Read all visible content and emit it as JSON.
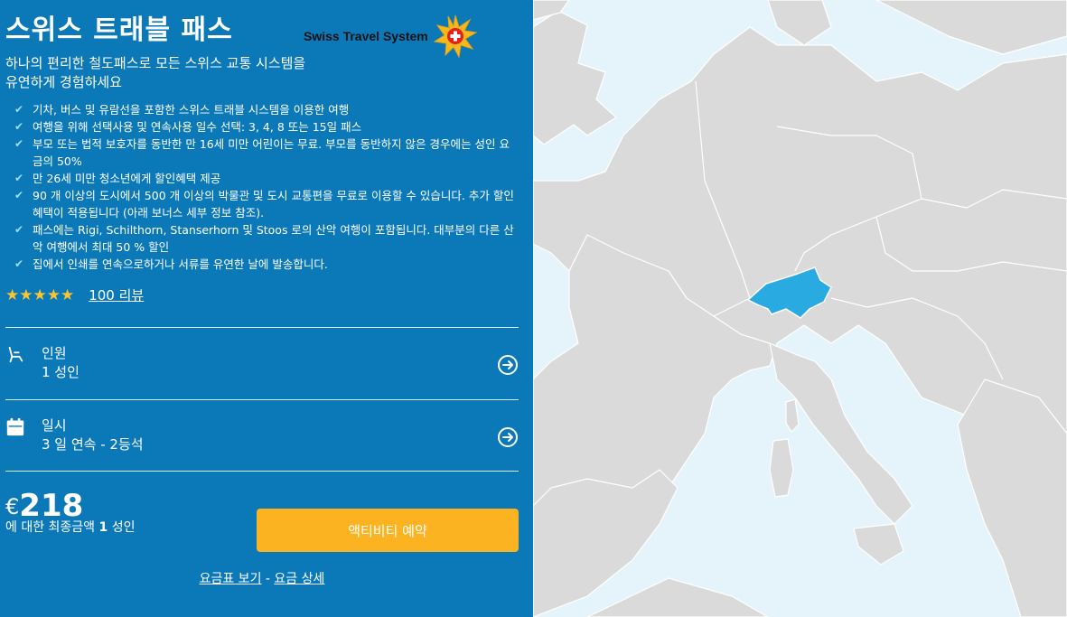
{
  "product": {
    "title": "스위스 트래블 패스",
    "logo_text": "Swiss Travel System",
    "subtitle": "하나의 편리한 철도패스로 모든 스위스 교통 시스템을 유연하게 경험하세요"
  },
  "features": [
    "기차, 버스 및 유람선을 포함한 스위스 트래블 시스템을 이용한 여행",
    "여행을 위해 선택사용 및 연속사용 일수 선택: 3, 4, 8 또는 15일 패스",
    "부모 또는 법적 보호자를 동반한 만 16세 미만 어린이는 무료. 부모를 동반하지 않은 경우에는 성인 요금의 50%",
    "만 26세 미만 청소년에게 할인혜택 제공",
    "90 개 이상의 도시에서 500 개 이상의 박물관 및 도시 교통편을 무료로 이용할 수 있습니다. 추가 할인 혜택이 적용됩니다 (아래 보너스 세부 정보 참조).",
    "패스에는 Rigi, Schilthorn, Stanserhorn 및 Stoos 로의 산악 여행이 포함됩니다. 대부분의 다른 산악 여행에서 최대 50 % 할인",
    "집에서 인쇄를 연속으로하거나 서류를 유연한 날에 발송합니다."
  ],
  "rating": {
    "stars": "★★★★★",
    "reviews_label": "100 리뷰"
  },
  "travellers": {
    "label": "인원",
    "value": "1 성인"
  },
  "date": {
    "label": "일시",
    "value": "3 일 연속 - 2등석"
  },
  "price": {
    "currency": "€",
    "amount": "218",
    "note_prefix": "에 대한 최종금액 ",
    "note_count": "1",
    "note_suffix": " 성인"
  },
  "book_button": "액티비티 예약",
  "links": {
    "fare_table": "요금표 보기",
    "separator": " - ",
    "fare_details": "요금 상세"
  },
  "colors": {
    "panel": "#0b79b8",
    "button": "#fbb321",
    "highlight": "#29abe2",
    "land": "#dadada",
    "sea": "#e5f4fb"
  }
}
